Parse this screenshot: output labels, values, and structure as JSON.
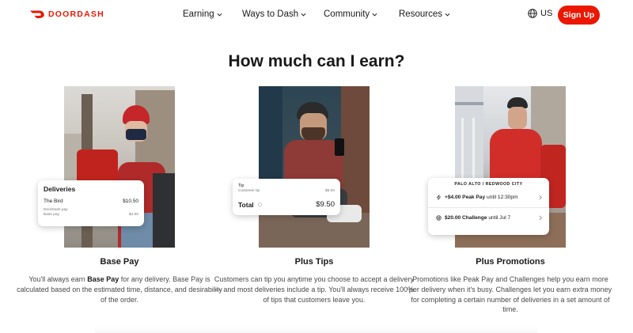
{
  "brand": {
    "name": "DOORDASH",
    "accent": "#eb1700"
  },
  "nav": {
    "items": [
      {
        "label": "Earning"
      },
      {
        "label": "Ways to Dash"
      },
      {
        "label": "Community"
      },
      {
        "label": "Resources"
      }
    ],
    "locale": "US",
    "signup_label": "Sign Up"
  },
  "section": {
    "heading": "How much can I earn?"
  },
  "columns": [
    {
      "title": "Base Pay",
      "desc_before": "You'll always earn ",
      "desc_bold": "Base Pay",
      "desc_after": " for any delivery. Base Pay is calculated based on the estimated time, distance, and desirability of the order."
    },
    {
      "title": "Plus Tips",
      "desc": "Customers can tip you anytime you choose to accept a delivery — and most deliveries include a tip. You'll always receive 100% of tips that customers leave you."
    },
    {
      "title": "Plus Promotions",
      "desc": "Promotions like Peak Pay and Challenges help you earn more per delivery when it's busy. Challenges let you earn extra money for completing a certain number of deliveries in a set amount of time."
    }
  ],
  "cards": {
    "deliveries": {
      "title": "Deliveries",
      "item": "The Bird",
      "item_value": "$10.50",
      "line1": "DoorDash pay",
      "line2": "Base pay",
      "line2_value": "$4.00"
    },
    "tip": {
      "label": "Tip",
      "sub_label": "Customer tip",
      "sub_value": "$5.00",
      "total_label": "Total",
      "total_value": "$9.50"
    },
    "promotions": {
      "location": "PALO ALTO / REDWOOD CITY",
      "peak_bold": "+$4.00 Peak Pay",
      "peak_rest": " until 12:30pm",
      "challenge_bold": "$20.00 Challenge",
      "challenge_rest": " until Jul 7"
    }
  },
  "icons": {
    "logo": "doordash-logo-icon",
    "chevron": "chevron-down-icon",
    "globe": "globe-icon",
    "info": "info-icon",
    "peak": "lightning-icon",
    "challenge": "target-icon",
    "arrow": "chevron-right-icon"
  }
}
